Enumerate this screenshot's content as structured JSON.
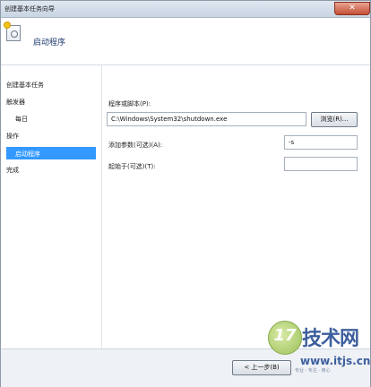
{
  "window": {
    "title": "创建基本任务向导",
    "close_symbol": "✕"
  },
  "header": {
    "title": "启动程序"
  },
  "sidebar": {
    "items": [
      {
        "label": "创建基本任务"
      },
      {
        "label": "触发器"
      },
      {
        "label": "每日"
      },
      {
        "label": "操作"
      },
      {
        "label": "启动程序",
        "active": true
      },
      {
        "label": "完成"
      }
    ]
  },
  "form": {
    "program_label": "程序或脚本(P):",
    "program_value": "C:\\Windows\\System32\\shutdown.exe",
    "browse_label": "浏览(R)...",
    "args_label": "添加参数(可选)(A):",
    "args_value": "-s",
    "start_in_label": "起始于(可选)(T):",
    "start_in_value": ""
  },
  "footer": {
    "back_label": "< 上一步(B)"
  },
  "watermark": {
    "badge": "17",
    "name": "技术网",
    "url": "www.itjs.cn",
    "sub": "专业 · 专注 · 用心"
  },
  "colors": {
    "accent": "#3399ff",
    "title_blue": "#1e3a6e",
    "watermark": "#3d5f9e"
  }
}
